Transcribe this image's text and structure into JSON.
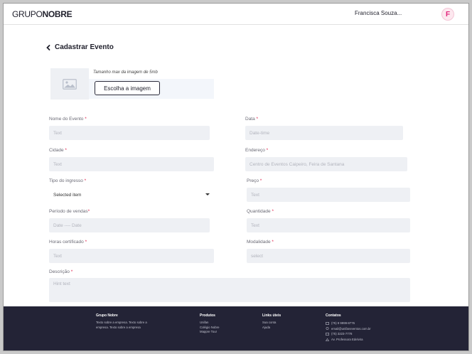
{
  "header": {
    "logo_light": "GRUPO",
    "logo_bold": "NOBRE",
    "user_name": "Francisca Souza...",
    "avatar_initial": "F"
  },
  "page": {
    "title": "Cadastrar Evento"
  },
  "image_upload": {
    "hint": "Tamanho max da imagem de 5mb",
    "button_label": "Escolha a imagem"
  },
  "form": {
    "nome": {
      "label": "Nome do Evento",
      "req": "*",
      "placeholder": "Text"
    },
    "data": {
      "label": "Data",
      "req": "*",
      "placeholder": "Date-time"
    },
    "cidade": {
      "label": "Cidade",
      "req": "*",
      "placeholder": "Text"
    },
    "endereco": {
      "label": "Endereço",
      "req": "*",
      "placeholder": "Centro de Eventos Caipeiro, Feira de Santana"
    },
    "tipo": {
      "label": "Tipo do ingresso",
      "req": "*",
      "value": "Selected item"
    },
    "preco": {
      "label": "Preço",
      "req": "*",
      "placeholder": "Text"
    },
    "periodo": {
      "label": "Período de vendas",
      "req": "*",
      "placeholder": "Date ---- Date"
    },
    "quantidade": {
      "label": "Quantidade",
      "req": "*",
      "placeholder": "Text"
    },
    "horas": {
      "label": "Horas certificado",
      "req": "*",
      "placeholder": "Text"
    },
    "modalidade": {
      "label": "Modalidade",
      "req": "*",
      "placeholder": "select"
    },
    "descricao": {
      "label": "Descrição",
      "req": "*",
      "placeholder": "Hint text"
    }
  },
  "footer": {
    "col1": {
      "title": "Grupo Nobre",
      "line1": "Texto sobre a empresa. Texto sobre a",
      "line2": "empresa. Texto sobre a empresa"
    },
    "col2": {
      "title": "Produtos",
      "items": [
        "Unifan",
        "Colégio Nobre",
        "Mappre Tour"
      ]
    },
    "col3": {
      "title": "Links úteis",
      "items": [
        "Sua conta",
        "Ajuda"
      ]
    },
    "col4": {
      "title": "Contatos",
      "phone1": "(75) 9 9999-8776",
      "email": "email@unifaneventos.com.br",
      "phone2": "(75) 3223-7778",
      "address": "Av. Professora Edelvira"
    }
  },
  "colors": {
    "accent": "#e0227a",
    "footer_bg": "#232336",
    "field_bg": "#eef0f4",
    "required": "#e0244e"
  },
  "icons": [
    "chevron-left-icon",
    "image-placeholder-icon",
    "caret-down-icon",
    "phone-icon",
    "mail-icon",
    "location-icon"
  ]
}
